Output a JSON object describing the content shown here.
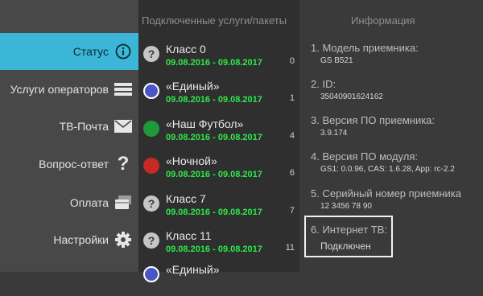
{
  "sidebar": {
    "items": [
      {
        "label": "Статус",
        "icon": "info-icon",
        "active": true
      },
      {
        "label": "Услуги операторов",
        "icon": "list-icon"
      },
      {
        "label": "ТВ-Почта",
        "icon": "envelope-icon"
      },
      {
        "label": "Вопрос-ответ",
        "icon": "question-icon"
      },
      {
        "label": "Оплата",
        "icon": "payment-cards-icon"
      },
      {
        "label": "Настройки",
        "icon": "gear-icon"
      }
    ]
  },
  "services": {
    "header": "Подключенные услуги/пакеты",
    "rows": [
      {
        "name": "Класс 0",
        "dates": "09.08.2016 - 09.08.2017",
        "num": "0",
        "icon": "question-icon"
      },
      {
        "name": "«Единый»",
        "dates": "09.08.2016 - 09.08.2017",
        "num": "1",
        "icon": "edinyi-logo-icon",
        "color": "#4a55c8"
      },
      {
        "name": "«Наш Футбол»",
        "dates": "09.08.2016 - 09.08.2017",
        "num": "4",
        "icon": "nash-futbol-logo-icon",
        "color": "#1f9a3a"
      },
      {
        "name": "«Ночной»",
        "dates": "09.08.2016 - 09.08.2017",
        "num": "6",
        "icon": "nochnoi-logo-icon",
        "color": "#c62a22"
      },
      {
        "name": "Класс 7",
        "dates": "09.08.2016 - 09.08.2017",
        "num": "7",
        "icon": "question-icon"
      },
      {
        "name": "Класс 11",
        "dates": "09.08.2016 - 09.08.2017",
        "num": "11",
        "icon": "question-icon"
      },
      {
        "name": "«Единый»",
        "dates": "",
        "num": "",
        "icon": "edinyi-logo-icon",
        "color": "#4a55c8"
      }
    ]
  },
  "info": {
    "header": "Информация",
    "items": [
      {
        "label": "1. Модель приемника:",
        "value": "GS B521"
      },
      {
        "label": "2. ID:",
        "value": "35040901624162"
      },
      {
        "label": "3. Версия ПО приемника:",
        "value": "3.9.174"
      },
      {
        "label": "4. Версия ПО модуля:",
        "value": "GS1: 0.0.96, CAS: 1.6.28, App: rc-2.2"
      },
      {
        "label": "5. Серийный номер приемника",
        "value": "12 3456 78 90"
      },
      {
        "label": "6. Интернет ТВ:",
        "value": "Подключен"
      }
    ]
  }
}
